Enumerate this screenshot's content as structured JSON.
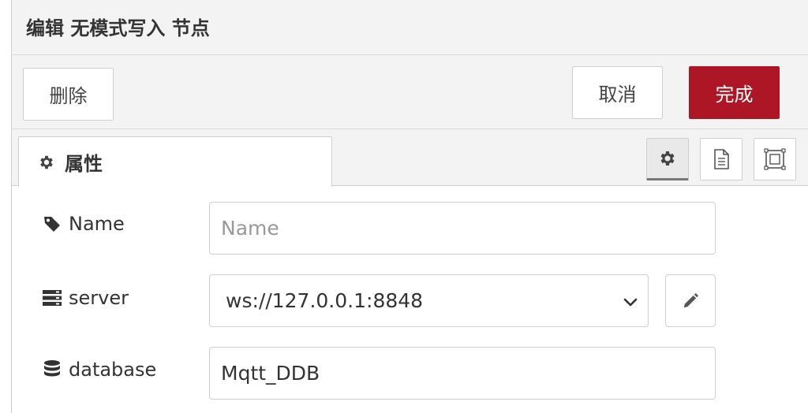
{
  "dialog": {
    "title": "编辑 无模式写入 节点"
  },
  "toolbar": {
    "delete_label": "删除",
    "cancel_label": "取消",
    "done_label": "完成"
  },
  "tabs": {
    "properties_label": "属性",
    "icons": [
      "gear-icon",
      "document-icon",
      "frame-icon"
    ]
  },
  "form": {
    "name": {
      "label": "Name",
      "value": "",
      "placeholder": "Name",
      "icon": "tag-icon"
    },
    "server": {
      "label": "server",
      "value": "ws://127.0.0.1:8848",
      "icon": "server-icon"
    },
    "database": {
      "label": "database",
      "value": "Mqtt_DDB",
      "icon": "database-icon"
    }
  },
  "colors": {
    "primary": "#ad1625",
    "panel_bg": "#f3f3f3",
    "border": "#cfcfcf"
  }
}
